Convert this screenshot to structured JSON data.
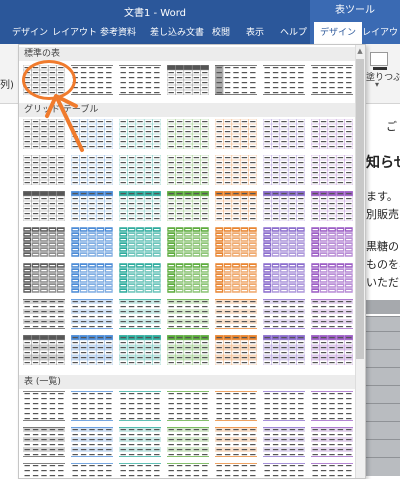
{
  "window": {
    "title": "文書1 - Word",
    "context_tab_group": "表ツール"
  },
  "ribbon_tabs": [
    "デザイン",
    "レイアウト",
    "参考資料",
    "差し込み文書",
    "校閲",
    "表示",
    "ヘルプ",
    "デザイン",
    "レイアウト"
  ],
  "active_tab_index": 7,
  "ribbon": {
    "left_fragment": "列)",
    "shading_label": "塗りつぶし"
  },
  "gallery": {
    "sections": [
      "標準の表",
      "グリッド テーブル",
      "表 (一覧)"
    ],
    "grid_table_rows": 7,
    "list_table_rows": 3,
    "columns": 7,
    "theme_colors": [
      "#5a5a5a",
      "#4a8ad6",
      "#2dab9d",
      "#5cab3c",
      "#e8842f",
      "#8a6ccc",
      "#9b5cc4"
    ],
    "selected": "標準の表 / 表 (格子)"
  },
  "document": {
    "lines": [
      "ご",
      "知らせ",
      "ます。",
      "別販売の",
      "黒糖の",
      "ものを、",
      "いただき"
    ]
  }
}
